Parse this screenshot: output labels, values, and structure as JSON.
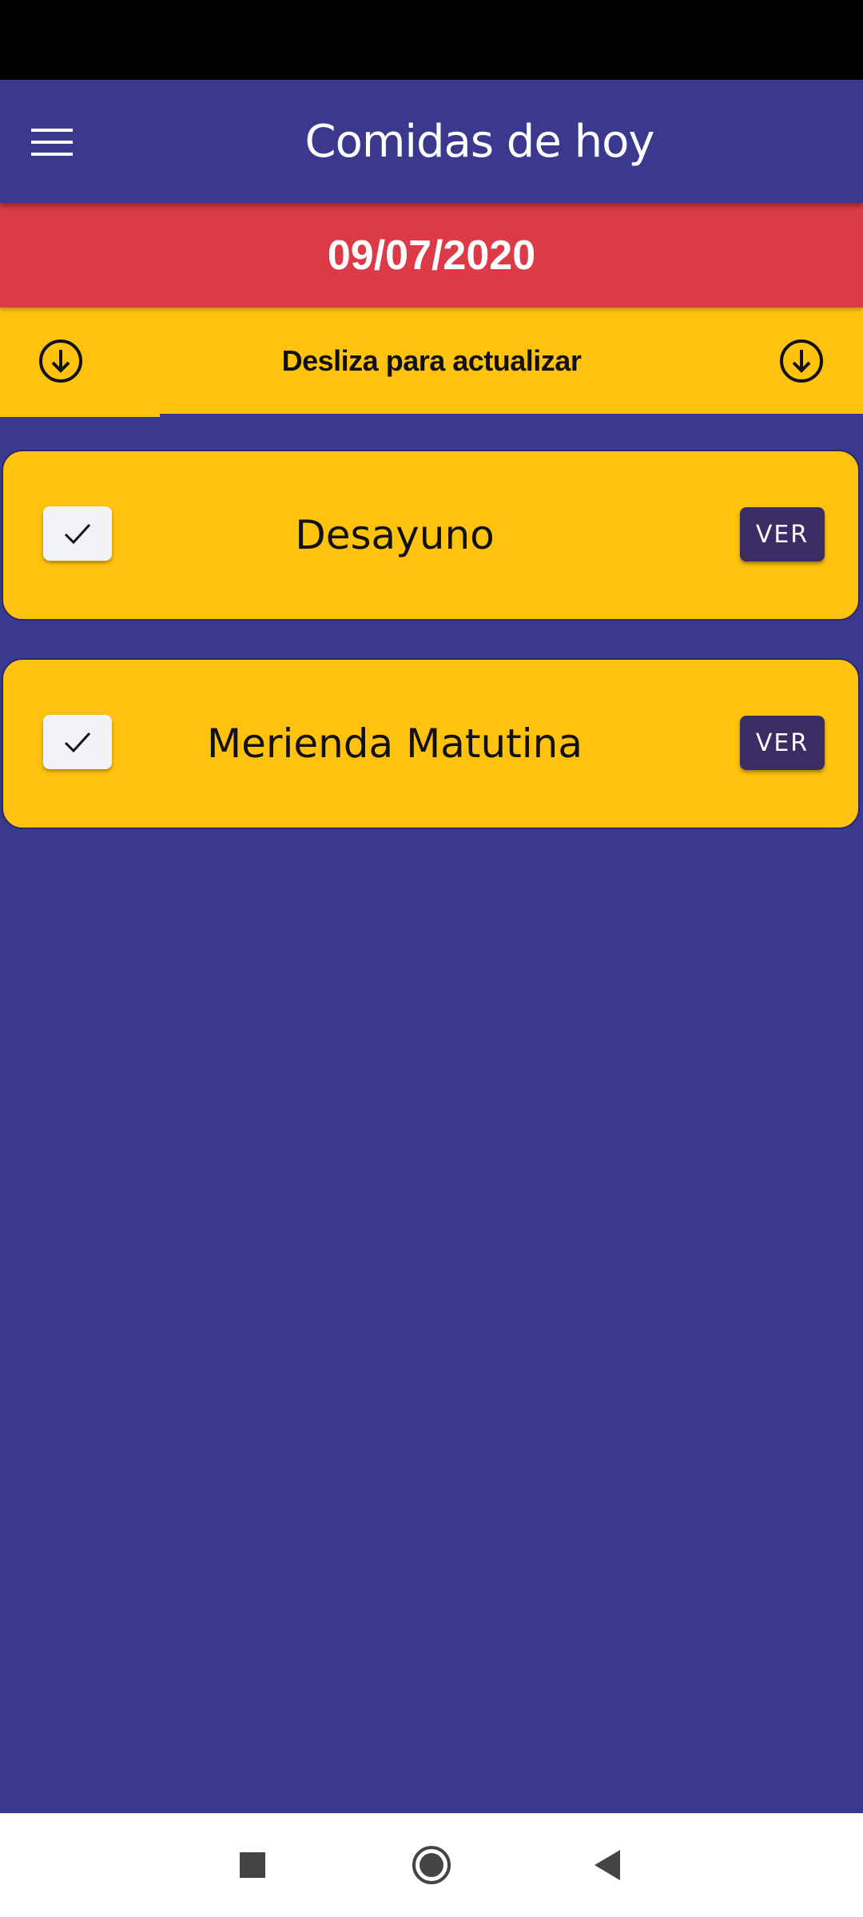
{
  "appbar": {
    "title": "Comidas de hoy",
    "menu_icon": "hamburger-menu-icon"
  },
  "date_banner": {
    "text": "09/07/2020",
    "color": "#dc3a47"
  },
  "refresh_banner": {
    "text": "Desliza para actualizar",
    "left_icon": "arrow-down-circle-icon",
    "right_icon": "arrow-down-circle-icon",
    "color": "#fec20f"
  },
  "meals": [
    {
      "name": "Desayuno",
      "checked": true,
      "button_label": "VER"
    },
    {
      "name": "Merienda Matutina",
      "checked": true,
      "button_label": "VER"
    }
  ],
  "navigation_bar": {
    "buttons": [
      "recent-apps-icon",
      "home-icon",
      "back-icon"
    ]
  },
  "colors": {
    "background": "#3a398e",
    "card": "#fec20f",
    "button": "#3b2c64"
  }
}
